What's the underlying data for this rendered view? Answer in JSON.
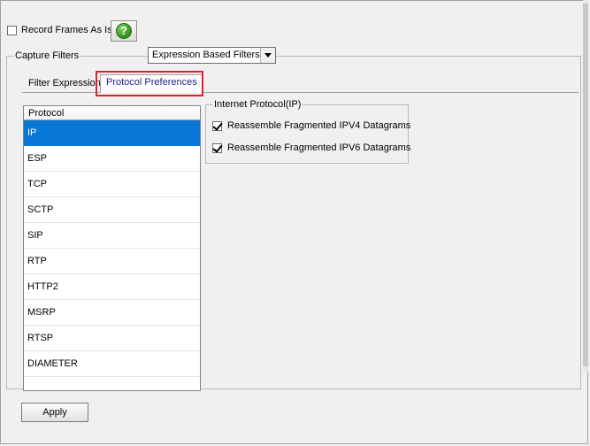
{
  "record_frames": {
    "label": "Record Frames As Is",
    "checked": false
  },
  "help_button": {
    "icon": "help-icon",
    "glyph": "?"
  },
  "capture_filters": {
    "title": "Capture Filters",
    "filter_type_selected": "Expression Based Filters"
  },
  "tabs": [
    {
      "label": "Filter Expression",
      "active": false
    },
    {
      "label": "Protocol Preferences",
      "active": true
    }
  ],
  "protocol_list": {
    "header": "Protocol",
    "items": [
      "IP",
      "ESP",
      "TCP",
      "SCTP",
      "SIP",
      "RTP",
      "HTTP2",
      "MSRP",
      "RTSP",
      "DIAMETER"
    ],
    "selected": "IP"
  },
  "ip_group": {
    "title": "Internet Protocol(IP)",
    "options": [
      {
        "label": "Reassemble Fragmented IPV4 Datagrams",
        "checked": true
      },
      {
        "label": "Reassemble Fragmented IPV6 Datagrams",
        "checked": true
      }
    ]
  },
  "apply_button": {
    "label": "Apply"
  },
  "colors": {
    "selection": "#0a78d7",
    "highlight": "#e0202a",
    "help_green": "#2f8f1b"
  }
}
